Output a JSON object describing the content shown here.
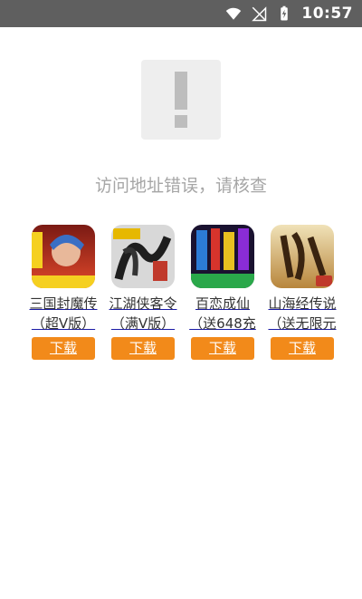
{
  "status_bar": {
    "time": "10:57"
  },
  "error": {
    "message": "访问地址错误，请核查"
  },
  "apps": [
    {
      "name": "三国封魔传（超V版）",
      "button": "下载"
    },
    {
      "name": "江湖侠客令（满V版）",
      "button": "下载"
    },
    {
      "name": "百恋成仙（送648充",
      "button": "下载"
    },
    {
      "name": "山海经传说（送无限元",
      "button": "下载"
    }
  ],
  "colors": {
    "status_bar": "#5f5f5f",
    "download_button": "#f28a1a",
    "error_text": "#a6a6a6"
  }
}
